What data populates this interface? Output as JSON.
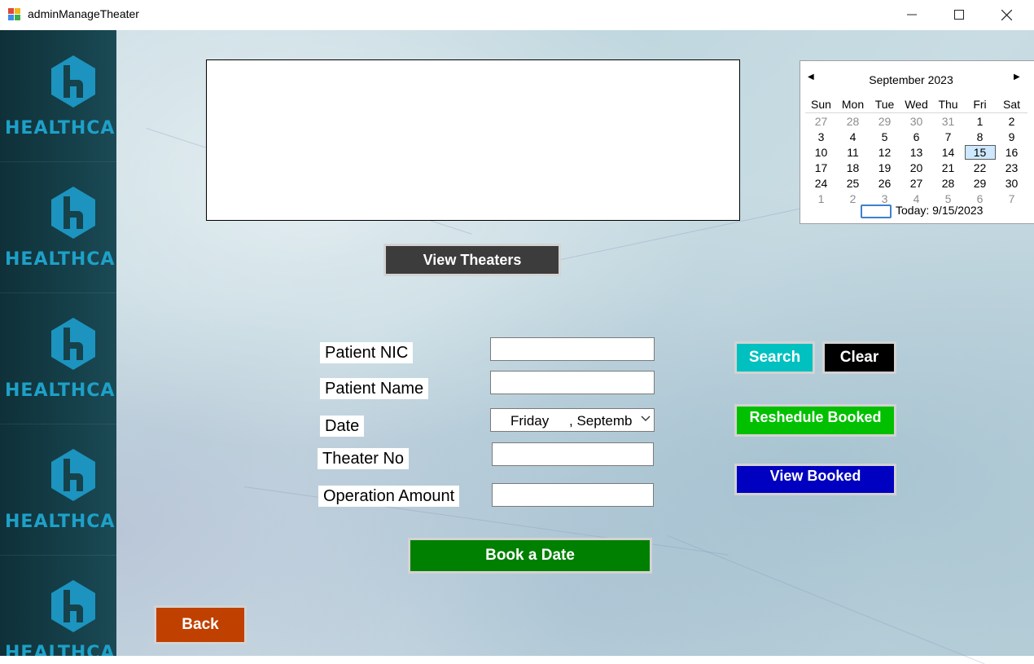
{
  "window": {
    "title": "adminManageTheater",
    "controls": {
      "minimize": "minimize-icon",
      "maximize": "maximize-icon",
      "close": "close-icon"
    }
  },
  "sidebar": {
    "brand_text": "HEALTHCARE",
    "logo_icon": "healthcare-h-logo-icon",
    "brand_color": "#1ea0c8",
    "repeat": 5
  },
  "calendar": {
    "month_title": "September 2023",
    "weekdays": [
      "Sun",
      "Mon",
      "Tue",
      "Wed",
      "Thu",
      "Fri",
      "Sat"
    ],
    "weeks": [
      [
        "27",
        "28",
        "29",
        "30",
        "31",
        "1",
        "2"
      ],
      [
        "3",
        "4",
        "5",
        "6",
        "7",
        "8",
        "9"
      ],
      [
        "10",
        "11",
        "12",
        "13",
        "14",
        "15",
        "16"
      ],
      [
        "17",
        "18",
        "19",
        "20",
        "21",
        "22",
        "23"
      ],
      [
        "24",
        "25",
        "26",
        "27",
        "28",
        "29",
        "30"
      ],
      [
        "1",
        "2",
        "3",
        "4",
        "5",
        "6",
        "7"
      ]
    ],
    "selected_day": "15",
    "today_label": "Today: 9/15/2023"
  },
  "buttons": {
    "view_theaters": "View Theaters",
    "search": "Search",
    "clear": "Clear",
    "reschedule": "Reshedule Booked",
    "view_booked": "View Booked",
    "book": "Book a Date",
    "back": "Back"
  },
  "form": {
    "patient_nic_label": "Patient NIC",
    "patient_name_label": "Patient Name",
    "date_label": "Date",
    "theater_no_label": "Theater No",
    "operation_amount_label": "Operation Amount",
    "date_day": "Friday",
    "date_month": ", Septembe",
    "patient_nic_value": "",
    "patient_name_value": "",
    "theater_no_value": "",
    "operation_amount_value": ""
  },
  "colors": {
    "view_theaters": "#3c3c3c",
    "search": "#00c0c0",
    "clear": "#000000",
    "reschedule": "#00c000",
    "view_booked": "#0000c0",
    "book": "#008000",
    "back": "#c04000"
  }
}
